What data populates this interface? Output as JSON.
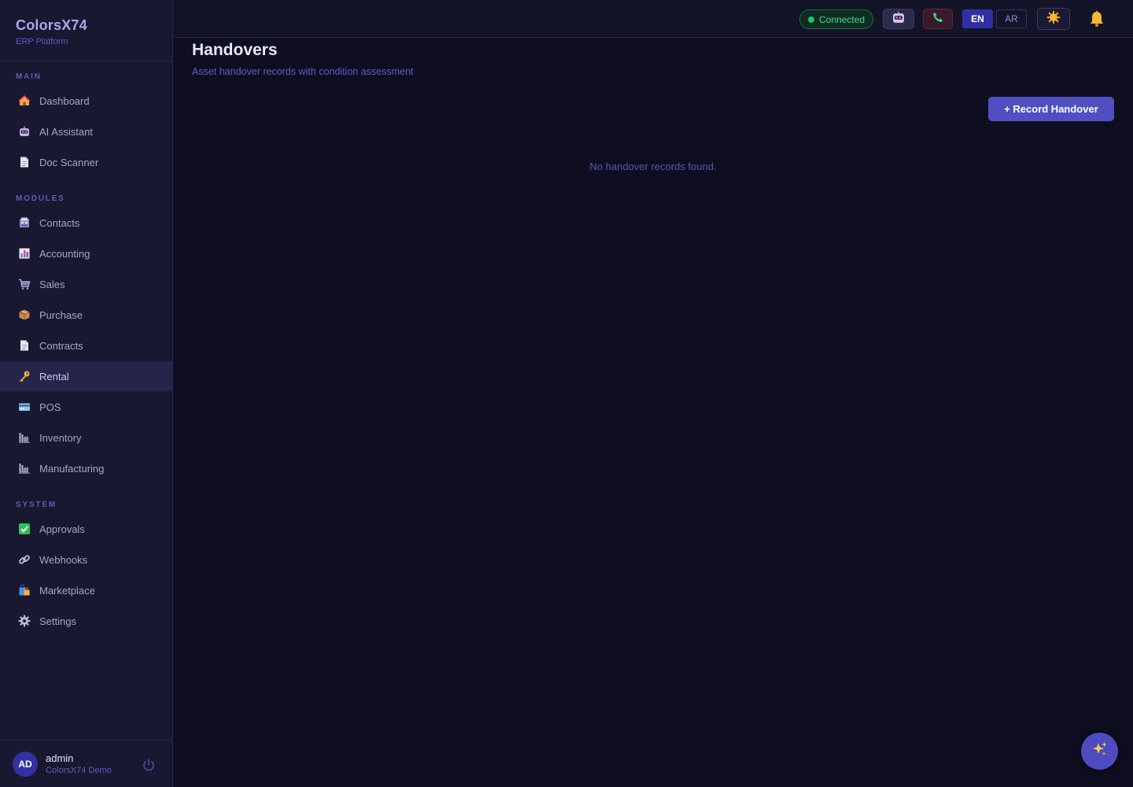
{
  "brand": {
    "title": "ColorsX74",
    "subtitle": "ERP Platform"
  },
  "sidebar": {
    "sections": {
      "main": "MAIN",
      "modules": "MODULES",
      "system": "SYSTEM"
    },
    "main_items": [
      {
        "label": "Dashboard",
        "icon": "house-icon"
      },
      {
        "label": "AI Assistant",
        "icon": "robot-icon"
      },
      {
        "label": "Doc Scanner",
        "icon": "document-icon"
      }
    ],
    "module_items": [
      {
        "label": "Contacts",
        "icon": "contacts-icon"
      },
      {
        "label": "Accounting",
        "icon": "bar-chart-icon"
      },
      {
        "label": "Sales",
        "icon": "cart-icon"
      },
      {
        "label": "Purchase",
        "icon": "package-icon"
      },
      {
        "label": "Contracts",
        "icon": "document-icon"
      },
      {
        "label": "Rental",
        "icon": "key-icon",
        "active": true
      },
      {
        "label": "POS",
        "icon": "credit-card-icon"
      },
      {
        "label": "Inventory",
        "icon": "factory-icon"
      },
      {
        "label": "Manufacturing",
        "icon": "factory-icon"
      }
    ],
    "system_items": [
      {
        "label": "Approvals",
        "icon": "check-box-icon"
      },
      {
        "label": "Webhooks",
        "icon": "link-icon"
      },
      {
        "label": "Marketplace",
        "icon": "shopping-bags-icon"
      },
      {
        "label": "Settings",
        "icon": "gear-icon"
      }
    ]
  },
  "user": {
    "initials": "AD",
    "name": "admin",
    "org": "ColorsX74 Demo"
  },
  "topbar": {
    "status": "Connected",
    "lang_en": "EN",
    "lang_ar": "AR"
  },
  "page": {
    "title": "Handovers",
    "subtitle": "Asset handover records with condition assessment",
    "record_button": "+ Record Handover",
    "empty_message": "No handover records found."
  },
  "colors": {
    "accent": "#4f4fc2",
    "status_connected": "#22c55e",
    "background": "#0e0e20",
    "sidebar": "#181830"
  }
}
